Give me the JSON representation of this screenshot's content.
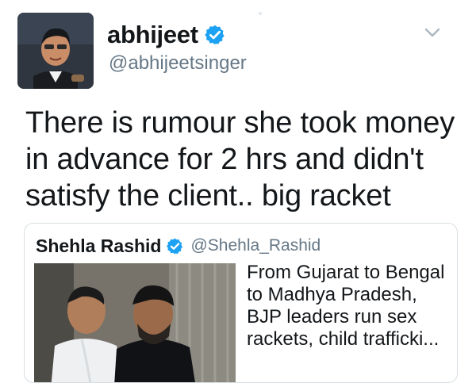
{
  "tweet": {
    "display_name": "abhijeet",
    "handle": "@abhijeetsinger",
    "text": "There is rumour she took money in advance for 2 hrs and didn't satisfy the client.. big racket"
  },
  "quoted_tweet": {
    "display_name": "Shehla Rashid",
    "handle": "@Shehla_Rashid",
    "text": "From Gujarat to Bengal to Madhya Pradesh, BJP leaders run sex rackets, child trafficki..."
  },
  "icons": {
    "verified": "verified-badge-icon",
    "menu": "chevron-down-icon"
  },
  "colors": {
    "verified_blue": "#1da1f2",
    "text_primary": "#14171a",
    "text_secondary": "#657786",
    "border": "#d8dee3"
  }
}
